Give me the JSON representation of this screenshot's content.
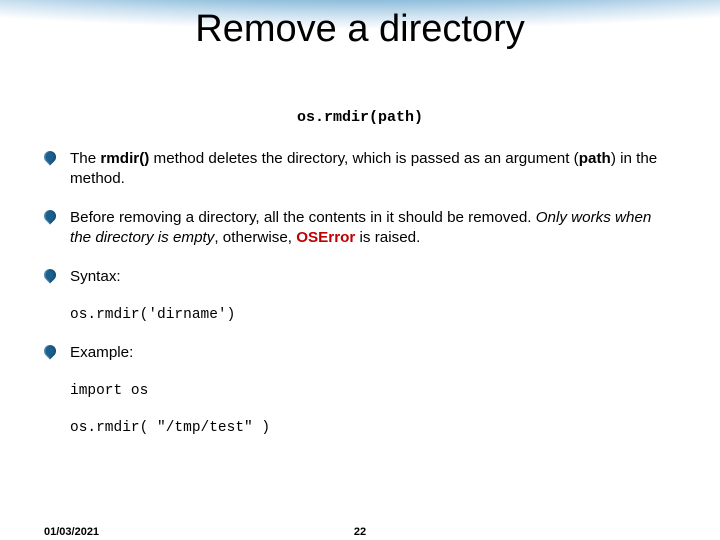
{
  "title": "Remove a directory",
  "signature": "os.rmdir(path)",
  "bullets": {
    "b1_pre": "The ",
    "b1_rmdir": "rmdir()",
    "b1_mid": " method deletes the directory, which is passed as an argument (",
    "b1_path": "path",
    "b1_post": ") in the method.",
    "b2_pre": "Before removing a directory, all the contents in it should be removed. ",
    "b2_ital": "Only works when the directory is empty",
    "b2_mid": ", otherwise, ",
    "b2_err": "OSError",
    "b2_post": " is raised.",
    "b3": "Syntax:",
    "b4": "Example:"
  },
  "code": {
    "syntax": "os.rmdir('dirname')",
    "ex1": "import os",
    "ex2": "os.rmdir( \"/tmp/test\" )"
  },
  "footer": {
    "date": "01/03/2021",
    "page": "22"
  }
}
